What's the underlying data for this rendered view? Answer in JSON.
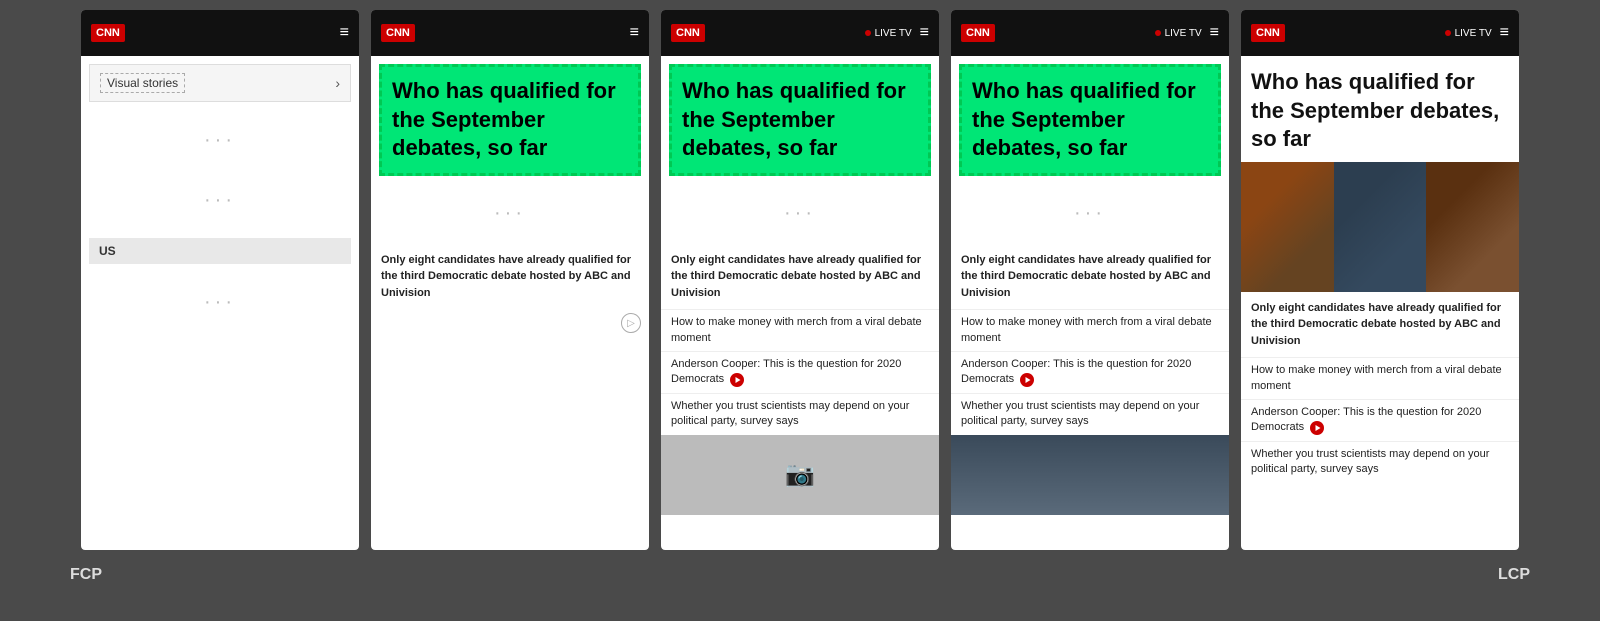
{
  "panels": [
    {
      "id": "panel1",
      "type": "visual-stories",
      "header": {
        "logo": "CNN",
        "showLiveTv": false,
        "menuIcon": "≡"
      },
      "visualStoriesLabel": "Visual stories",
      "sectionLabel": "US"
    },
    {
      "id": "panel2",
      "type": "article",
      "header": {
        "logo": "CNN",
        "showLiveTv": false,
        "menuIcon": "≡"
      },
      "title": "Who has qualified for the September debates, so far",
      "titleHighlighted": true,
      "mainText": "Only eight candidates have already qualified for the third Democratic debate hosted by ABC and Univision",
      "subItems": [],
      "showScrollIndicator": true
    },
    {
      "id": "panel3",
      "type": "article",
      "header": {
        "logo": "CNN",
        "showLiveTv": true,
        "liveTvText": "LIVE TV",
        "menuIcon": "≡"
      },
      "title": "Who has qualified for the September debates, so far",
      "titleHighlighted": true,
      "mainText": "Only eight candidates have already qualified for the third Democratic debate hosted by ABC and Univision",
      "subItems": [
        "How to make money with merch from a viral debate moment",
        "Anderson Cooper: This is the question for 2020 Democrats",
        "Whether you trust scientists may depend on your political party, survey says"
      ],
      "showGrayImage": true
    },
    {
      "id": "panel4",
      "type": "article",
      "header": {
        "logo": "CNN",
        "showLiveTv": true,
        "liveTvText": "LIVE TV",
        "menuIcon": "≡"
      },
      "title": "Who has qualified for the September debates, so far",
      "titleHighlighted": true,
      "mainText": "Only eight candidates have already qualified for the third Democratic debate hosted by ABC and Univision",
      "subItems": [
        "How to make money with merch from a viral debate moment",
        "Anderson Cooper: This is the question for 2020 Democrats",
        "Whether you trust scientists may depend on your political party, survey says"
      ],
      "showRealImage": true
    },
    {
      "id": "panel5",
      "type": "article",
      "header": {
        "logo": "CNN",
        "showLiveTv": true,
        "liveTvText": "LIVE TV",
        "menuIcon": "≡"
      },
      "title": "Who has qualified for the September debates, so far",
      "titleHighlighted": false,
      "mainText": "Only eight candidates have already qualified for the third Democratic debate hosted by ABC and Univision",
      "subItems": [
        "How to make money with merch from a viral debate moment",
        "Anderson Cooper: This is the question for 2020 Democrats",
        "Whether you trust scientists may depend on your political party, survey says"
      ],
      "showPersonImage": true
    }
  ],
  "labels": {
    "fcp": "FCP",
    "lcp": "LCP"
  }
}
